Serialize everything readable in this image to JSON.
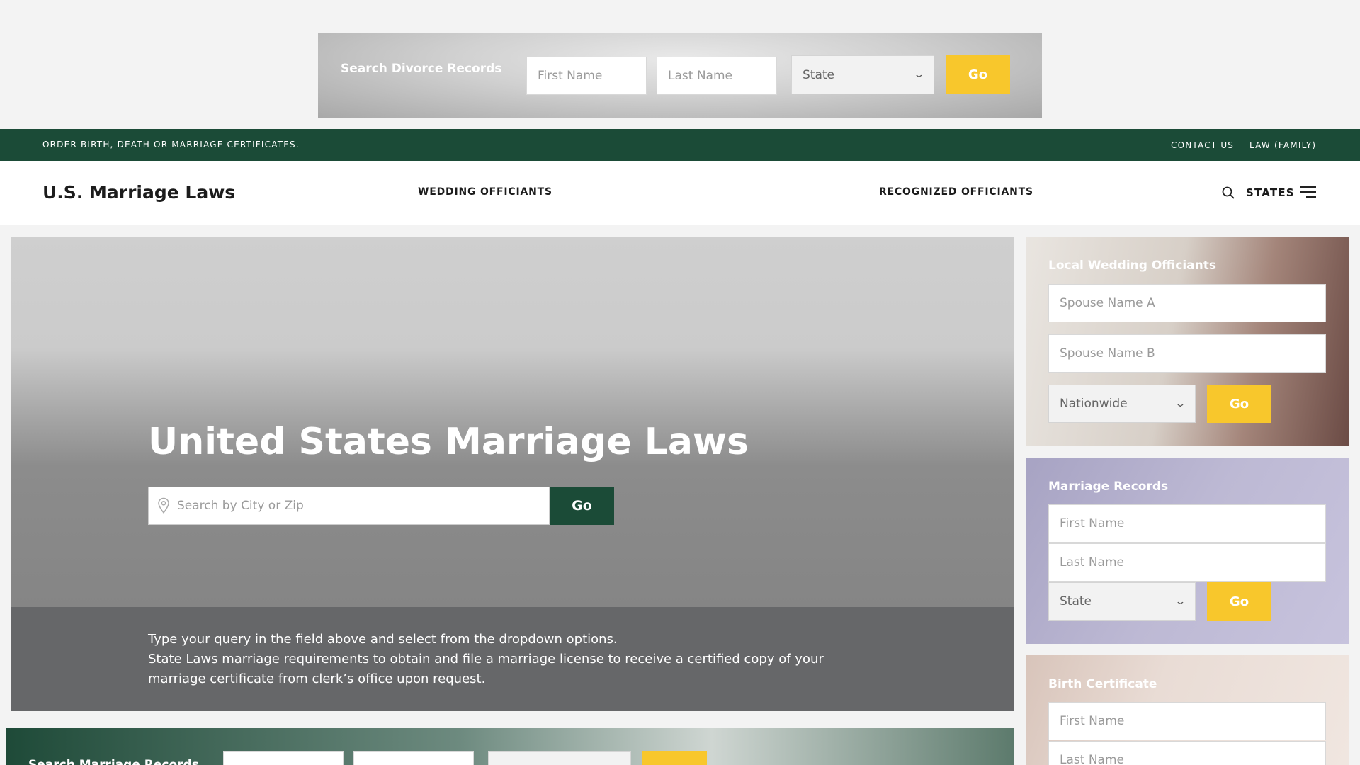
{
  "top_ad": {
    "label": "Search Divorce Records",
    "first_name_placeholder": "First Name",
    "last_name_placeholder": "Last Name",
    "state_value": "State",
    "go_label": "Go"
  },
  "topbar": {
    "tagline": "ORDER BIRTH, DEATH OR MARRIAGE CERTIFICATES.",
    "contact": "CONTACT US",
    "law": "LAW (FAMILY)"
  },
  "header": {
    "logo": "U.S. Marriage Laws",
    "nav_wedding": "WEDDING OFFICIANTS",
    "nav_recognized": "RECOGNIZED OFFICIANTS",
    "states": "STATES"
  },
  "hero": {
    "title": "United States Marriage Laws",
    "search_placeholder": "Search by City or Zip",
    "go_label": "Go",
    "line1": "Type your query in the field above and select from the dropdown options.",
    "line2": "State Laws marriage requirements to obtain and file a marriage license to receive a certified copy of your marriage certificate from clerk’s office upon request."
  },
  "bottom_band": {
    "label": "Search Marriage Records"
  },
  "sidebar": {
    "officiants": {
      "title": "Local Wedding Officiants",
      "spouse_a_placeholder": "Spouse Name A",
      "spouse_b_placeholder": "Spouse Name B",
      "scope_value": "Nationwide",
      "go_label": "Go"
    },
    "marriage_records": {
      "title": "Marriage Records",
      "first_name_placeholder": "First Name",
      "last_name_placeholder": "Last Name",
      "state_value": "State",
      "go_label": "Go"
    },
    "birth_certificate": {
      "title": "Birth Certificate",
      "first_name_placeholder": "First Name",
      "last_name_placeholder": "Last Name"
    }
  },
  "colors": {
    "brand_green": "#1b4b37",
    "accent_yellow": "#f8c72c"
  }
}
